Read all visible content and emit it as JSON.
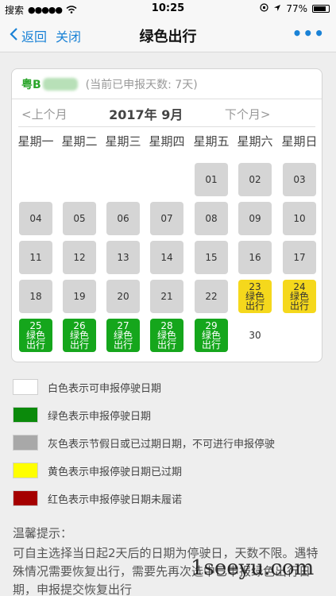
{
  "status_bar": {
    "carrier": "搜索",
    "signal": "●●●●●",
    "time": "10:25",
    "battery": "77%"
  },
  "nav": {
    "back_label": "返回",
    "close_label": "关闭",
    "title": "绿色出行",
    "more_label": "•••"
  },
  "calendar": {
    "plate": "粤B",
    "count_text": "(当前已申报天数: 7天)",
    "prev_label": "<上个月",
    "month_label": "2017年 9月",
    "next_label": "下个月>",
    "weekdays": [
      "星期一",
      "星期二",
      "星期三",
      "星期四",
      "星期五",
      "星期六",
      "星期日"
    ],
    "day_status_label": "绿色出行",
    "days": [
      {
        "day": "01",
        "col": 4,
        "row": 0,
        "state": "gray"
      },
      {
        "day": "02",
        "col": 5,
        "row": 0,
        "state": "gray"
      },
      {
        "day": "03",
        "col": 6,
        "row": 0,
        "state": "gray"
      },
      {
        "day": "04",
        "col": 0,
        "row": 1,
        "state": "gray"
      },
      {
        "day": "05",
        "col": 1,
        "row": 1,
        "state": "gray"
      },
      {
        "day": "06",
        "col": 2,
        "row": 1,
        "state": "gray"
      },
      {
        "day": "07",
        "col": 3,
        "row": 1,
        "state": "gray"
      },
      {
        "day": "08",
        "col": 4,
        "row": 1,
        "state": "gray"
      },
      {
        "day": "09",
        "col": 5,
        "row": 1,
        "state": "gray"
      },
      {
        "day": "10",
        "col": 6,
        "row": 1,
        "state": "gray"
      },
      {
        "day": "11",
        "col": 0,
        "row": 2,
        "state": "gray"
      },
      {
        "day": "12",
        "col": 1,
        "row": 2,
        "state": "gray"
      },
      {
        "day": "13",
        "col": 2,
        "row": 2,
        "state": "gray"
      },
      {
        "day": "14",
        "col": 3,
        "row": 2,
        "state": "gray"
      },
      {
        "day": "15",
        "col": 4,
        "row": 2,
        "state": "gray"
      },
      {
        "day": "16",
        "col": 5,
        "row": 2,
        "state": "gray"
      },
      {
        "day": "17",
        "col": 6,
        "row": 2,
        "state": "gray"
      },
      {
        "day": "18",
        "col": 0,
        "row": 3,
        "state": "gray"
      },
      {
        "day": "19",
        "col": 1,
        "row": 3,
        "state": "gray"
      },
      {
        "day": "20",
        "col": 2,
        "row": 3,
        "state": "gray"
      },
      {
        "day": "21",
        "col": 3,
        "row": 3,
        "state": "gray"
      },
      {
        "day": "22",
        "col": 4,
        "row": 3,
        "state": "gray"
      },
      {
        "day": "23",
        "col": 5,
        "row": 3,
        "state": "yellow"
      },
      {
        "day": "24",
        "col": 6,
        "row": 3,
        "state": "yellow"
      },
      {
        "day": "25",
        "col": 0,
        "row": 4,
        "state": "green"
      },
      {
        "day": "26",
        "col": 1,
        "row": 4,
        "state": "green"
      },
      {
        "day": "27",
        "col": 2,
        "row": 4,
        "state": "green"
      },
      {
        "day": "28",
        "col": 3,
        "row": 4,
        "state": "green"
      },
      {
        "day": "29",
        "col": 4,
        "row": 4,
        "state": "green"
      },
      {
        "day": "30",
        "col": 5,
        "row": 4,
        "state": "plain"
      }
    ]
  },
  "legend": [
    {
      "color": "#ffffff",
      "label": "白色表示可申报停驶日期"
    },
    {
      "color": "#0b8a0b",
      "label": "绿色表示申报停驶日期"
    },
    {
      "color": "#a8a8a8",
      "label": "灰色表示节假日或已过期日期，不可进行申报停驶"
    },
    {
      "color": "#ffff00",
      "label": "黄色表示申报停驶日期已过期"
    },
    {
      "color": "#a50000",
      "label": "红色表示申报停驶日期未履诺"
    }
  ],
  "tips": {
    "title": "温馨提示：",
    "body": "可自主选择当日起2天后的日期为停驶日，天数不限。遇特殊情况需要恢复出行，需要先再次选中已申报绿色出行日期，申报提交恢复出行"
  },
  "watermark": "1seeyu.com"
}
